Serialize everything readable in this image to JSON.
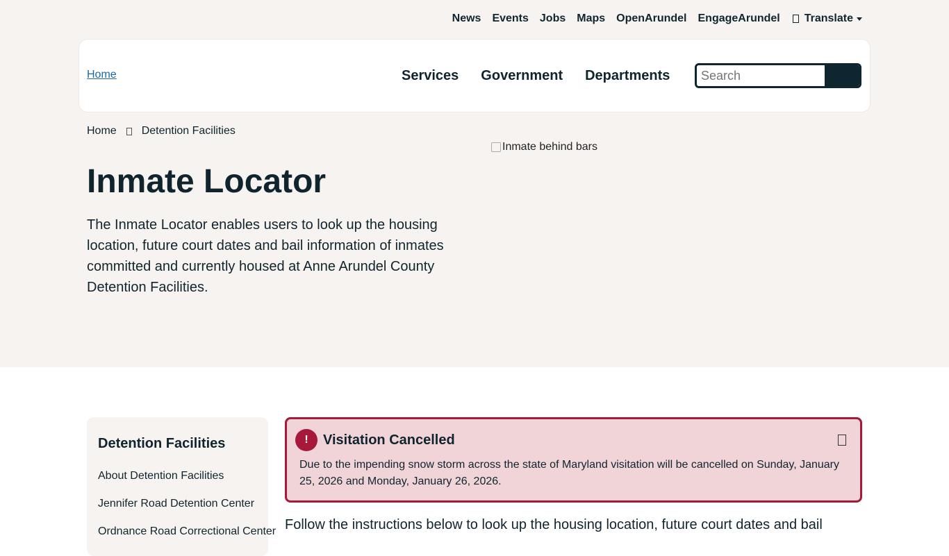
{
  "utility_nav": {
    "items": [
      "News",
      "Events",
      "Jobs",
      "Maps",
      "OpenArundel",
      "EngageArundel"
    ],
    "translate_label": "Translate"
  },
  "header": {
    "logo_alt": "Home",
    "nav": [
      "Services",
      "Government",
      "Departments"
    ],
    "search_placeholder": "Search"
  },
  "breadcrumb": {
    "home": "Home",
    "current": "Detention Facilities"
  },
  "hero": {
    "title": "Inmate Locator",
    "description": "The Inmate Locator enables users to look up the housing location, future court dates and bail information of inmates committed and currently housed at Anne Arundel County Detention Facilities.",
    "image_alt": "Inmate behind bars"
  },
  "sidebar": {
    "title": "Detention Facilities",
    "links": [
      "About Detention Facilities",
      "Jennifer Road Detention Center",
      "Ordnance Road Correctional Center"
    ]
  },
  "alert": {
    "icon": "!",
    "title": "Visitation Cancelled",
    "body": "Due to the impending snow storm across the state of Maryland visitation will be cancelled on Sunday, January 25, 2026 and Monday, January 26, 2026."
  },
  "main": {
    "intro": "Follow the instructions below to look up the housing location, future court dates and bail"
  },
  "colors": {
    "hero_bg": "#f7f3f0",
    "primary_dark": "#0f2530",
    "alert_border": "#a6193a",
    "alert_bg": "#f0d4d8"
  }
}
